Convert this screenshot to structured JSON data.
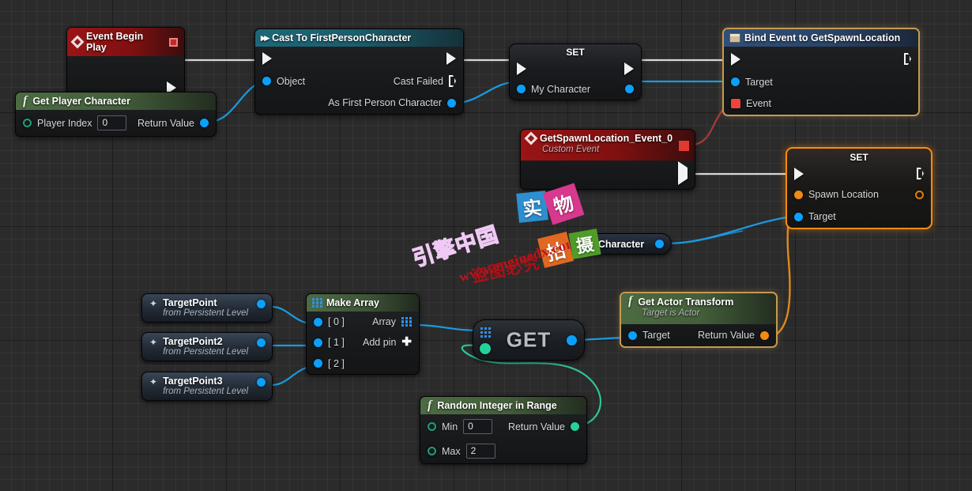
{
  "app": {
    "name": "Unreal Engine Blueprint Graph"
  },
  "nodes": {
    "event_begin_play": {
      "title": "Event Begin Play",
      "icon": "event-diamond-icon"
    },
    "get_player_character": {
      "title": "Get Player Character",
      "icon": "function-f-icon",
      "input_label": "Player Index",
      "input_value": "0",
      "output_label": "Return Value"
    },
    "cast_to_fpc": {
      "title": "Cast To FirstPersonCharacter",
      "icon": "cast-arrow-icon",
      "input_label": "Object",
      "out_failed_label": "Cast Failed",
      "out_value_label": "As First Person Character"
    },
    "set_my_character": {
      "title": "SET",
      "pin_label": "My Character"
    },
    "bind_event": {
      "title": "Bind Event to GetSpawnLocation",
      "icon": "bind-event-icon",
      "pin_target": "Target",
      "pin_event": "Event"
    },
    "custom_event": {
      "title": "GetSpawnLocation_Event_0",
      "subtitle": "Custom Event",
      "icon": "event-diamond-icon"
    },
    "set_spawn_location": {
      "title": "SET",
      "pin_spawn": "Spawn Location",
      "pin_target": "Target"
    },
    "my_character_var": {
      "title": "My Character"
    },
    "target_points": [
      {
        "title": "TargetPoint",
        "subtitle": "from Persistent Level"
      },
      {
        "title": "TargetPoint2",
        "subtitle": "from Persistent Level"
      },
      {
        "title": "TargetPoint3",
        "subtitle": "from Persistent Level"
      }
    ],
    "make_array": {
      "title": "Make Array",
      "icon": "array-grid-icon",
      "inputs": [
        "[ 0 ]",
        "[ 1 ]",
        "[ 2 ]"
      ],
      "output_label": "Array",
      "add_pin_label": "Add pin"
    },
    "get_array_item": {
      "title": "GET",
      "icon": "array-grid-icon"
    },
    "get_actor_transform": {
      "title": "Get Actor Transform",
      "subtitle": "Target is Actor",
      "icon": "function-f-icon",
      "pin_target": "Target",
      "pin_return": "Return Value"
    },
    "random_integer": {
      "title": "Random Integer in Range",
      "icon": "function-f-icon",
      "min_label": "Min",
      "min_value": "0",
      "max_label": "Max",
      "max_value": "2",
      "output_label": "Return Value"
    }
  },
  "watermark": {
    "brand_cn": "引擎中国",
    "url": "www.enginedx.com",
    "warning_cn": "盗图必究",
    "tiles": [
      {
        "char": "实",
        "color": "#2e8fd0"
      },
      {
        "char": "物",
        "color": "#d9388f"
      },
      {
        "char": "拍",
        "color": "#e06820"
      },
      {
        "char": "摄",
        "color": "#4f9c27"
      }
    ]
  },
  "colors": {
    "exec_wire": "#d8d8d8",
    "object_wire": "#1b9ae0",
    "delegate_wire": "#a03a3a",
    "transform_wire": "#e08a18",
    "int_wire": "#2fc49a",
    "selection_orange": "#ff8c0a",
    "selection_tan": "#c49a52"
  }
}
